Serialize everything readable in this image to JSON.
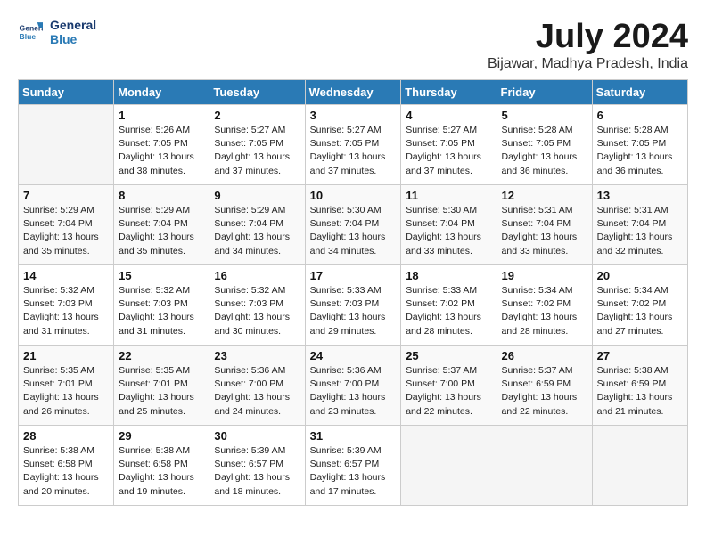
{
  "header": {
    "logo_line1": "General",
    "logo_line2": "Blue",
    "month": "July 2024",
    "location": "Bijawar, Madhya Pradesh, India"
  },
  "days_of_week": [
    "Sunday",
    "Monday",
    "Tuesday",
    "Wednesday",
    "Thursday",
    "Friday",
    "Saturday"
  ],
  "weeks": [
    [
      {
        "day": "",
        "info": ""
      },
      {
        "day": "1",
        "info": "Sunrise: 5:26 AM\nSunset: 7:05 PM\nDaylight: 13 hours\nand 38 minutes."
      },
      {
        "day": "2",
        "info": "Sunrise: 5:27 AM\nSunset: 7:05 PM\nDaylight: 13 hours\nand 37 minutes."
      },
      {
        "day": "3",
        "info": "Sunrise: 5:27 AM\nSunset: 7:05 PM\nDaylight: 13 hours\nand 37 minutes."
      },
      {
        "day": "4",
        "info": "Sunrise: 5:27 AM\nSunset: 7:05 PM\nDaylight: 13 hours\nand 37 minutes."
      },
      {
        "day": "5",
        "info": "Sunrise: 5:28 AM\nSunset: 7:05 PM\nDaylight: 13 hours\nand 36 minutes."
      },
      {
        "day": "6",
        "info": "Sunrise: 5:28 AM\nSunset: 7:05 PM\nDaylight: 13 hours\nand 36 minutes."
      }
    ],
    [
      {
        "day": "7",
        "info": "Sunrise: 5:29 AM\nSunset: 7:04 PM\nDaylight: 13 hours\nand 35 minutes."
      },
      {
        "day": "8",
        "info": "Sunrise: 5:29 AM\nSunset: 7:04 PM\nDaylight: 13 hours\nand 35 minutes."
      },
      {
        "day": "9",
        "info": "Sunrise: 5:29 AM\nSunset: 7:04 PM\nDaylight: 13 hours\nand 34 minutes."
      },
      {
        "day": "10",
        "info": "Sunrise: 5:30 AM\nSunset: 7:04 PM\nDaylight: 13 hours\nand 34 minutes."
      },
      {
        "day": "11",
        "info": "Sunrise: 5:30 AM\nSunset: 7:04 PM\nDaylight: 13 hours\nand 33 minutes."
      },
      {
        "day": "12",
        "info": "Sunrise: 5:31 AM\nSunset: 7:04 PM\nDaylight: 13 hours\nand 33 minutes."
      },
      {
        "day": "13",
        "info": "Sunrise: 5:31 AM\nSunset: 7:04 PM\nDaylight: 13 hours\nand 32 minutes."
      }
    ],
    [
      {
        "day": "14",
        "info": "Sunrise: 5:32 AM\nSunset: 7:03 PM\nDaylight: 13 hours\nand 31 minutes."
      },
      {
        "day": "15",
        "info": "Sunrise: 5:32 AM\nSunset: 7:03 PM\nDaylight: 13 hours\nand 31 minutes."
      },
      {
        "day": "16",
        "info": "Sunrise: 5:32 AM\nSunset: 7:03 PM\nDaylight: 13 hours\nand 30 minutes."
      },
      {
        "day": "17",
        "info": "Sunrise: 5:33 AM\nSunset: 7:03 PM\nDaylight: 13 hours\nand 29 minutes."
      },
      {
        "day": "18",
        "info": "Sunrise: 5:33 AM\nSunset: 7:02 PM\nDaylight: 13 hours\nand 28 minutes."
      },
      {
        "day": "19",
        "info": "Sunrise: 5:34 AM\nSunset: 7:02 PM\nDaylight: 13 hours\nand 28 minutes."
      },
      {
        "day": "20",
        "info": "Sunrise: 5:34 AM\nSunset: 7:02 PM\nDaylight: 13 hours\nand 27 minutes."
      }
    ],
    [
      {
        "day": "21",
        "info": "Sunrise: 5:35 AM\nSunset: 7:01 PM\nDaylight: 13 hours\nand 26 minutes."
      },
      {
        "day": "22",
        "info": "Sunrise: 5:35 AM\nSunset: 7:01 PM\nDaylight: 13 hours\nand 25 minutes."
      },
      {
        "day": "23",
        "info": "Sunrise: 5:36 AM\nSunset: 7:00 PM\nDaylight: 13 hours\nand 24 minutes."
      },
      {
        "day": "24",
        "info": "Sunrise: 5:36 AM\nSunset: 7:00 PM\nDaylight: 13 hours\nand 23 minutes."
      },
      {
        "day": "25",
        "info": "Sunrise: 5:37 AM\nSunset: 7:00 PM\nDaylight: 13 hours\nand 22 minutes."
      },
      {
        "day": "26",
        "info": "Sunrise: 5:37 AM\nSunset: 6:59 PM\nDaylight: 13 hours\nand 22 minutes."
      },
      {
        "day": "27",
        "info": "Sunrise: 5:38 AM\nSunset: 6:59 PM\nDaylight: 13 hours\nand 21 minutes."
      }
    ],
    [
      {
        "day": "28",
        "info": "Sunrise: 5:38 AM\nSunset: 6:58 PM\nDaylight: 13 hours\nand 20 minutes."
      },
      {
        "day": "29",
        "info": "Sunrise: 5:38 AM\nSunset: 6:58 PM\nDaylight: 13 hours\nand 19 minutes."
      },
      {
        "day": "30",
        "info": "Sunrise: 5:39 AM\nSunset: 6:57 PM\nDaylight: 13 hours\nand 18 minutes."
      },
      {
        "day": "31",
        "info": "Sunrise: 5:39 AM\nSunset: 6:57 PM\nDaylight: 13 hours\nand 17 minutes."
      },
      {
        "day": "",
        "info": ""
      },
      {
        "day": "",
        "info": ""
      },
      {
        "day": "",
        "info": ""
      }
    ]
  ]
}
